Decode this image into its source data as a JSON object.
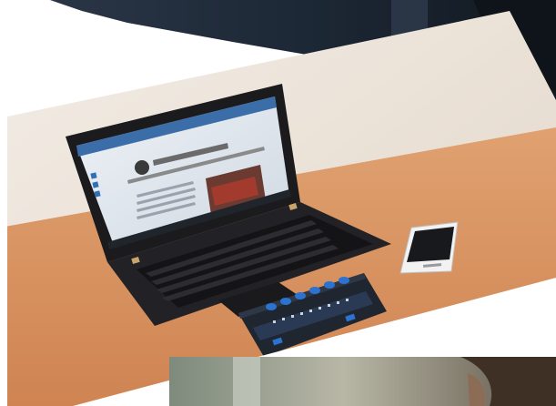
{
  "scene": {
    "description_icons": [
      "laptop-icon",
      "smartphone-icon",
      "braille-display-icon"
    ],
    "colors": {
      "background": "#ffffff",
      "wall": "#e9e1d8",
      "desk": "#d9925e",
      "laptop": "#1b1b1d",
      "screen": "#dfe6ee",
      "braille_device": "#1f2630",
      "braille_keys": "#2b72d1",
      "phone_body": "#f2f2f2",
      "phone_screen": "#17191d"
    }
  }
}
